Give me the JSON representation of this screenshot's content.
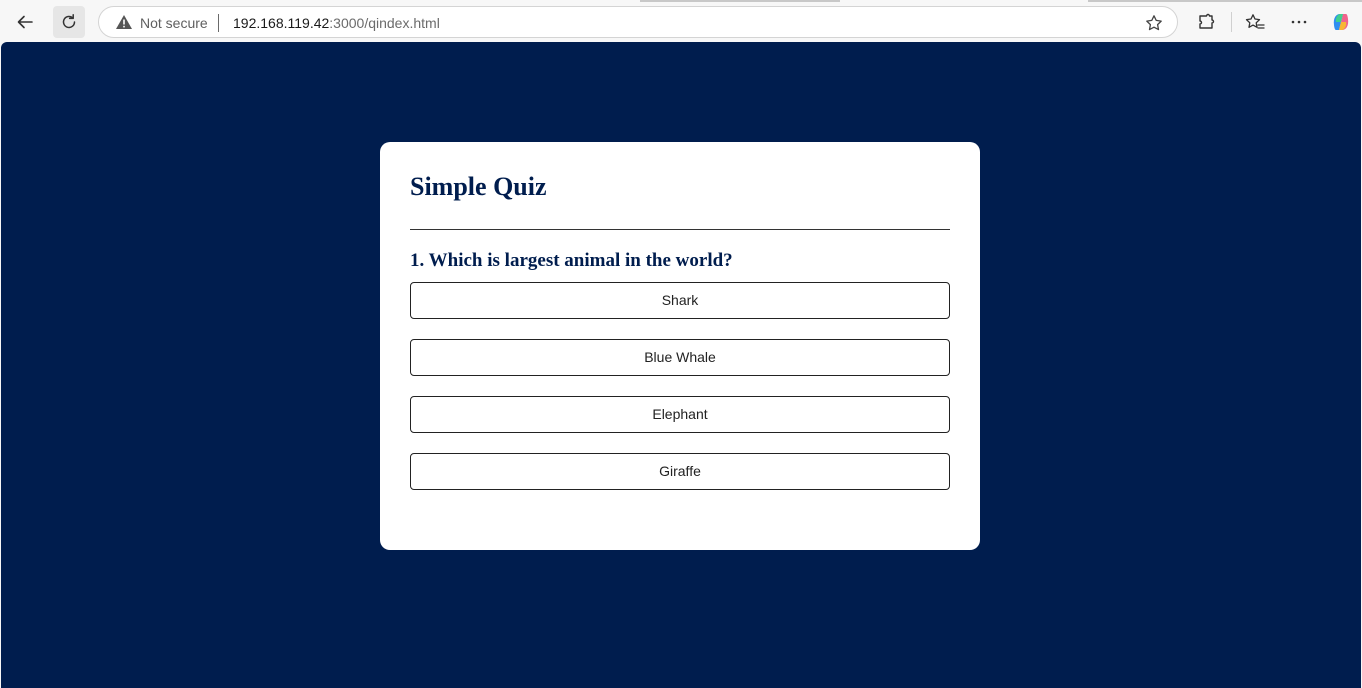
{
  "browser": {
    "security_label": "Not secure",
    "url_host": "192.168.119.42",
    "url_path": ":3000/qindex.html",
    "icons": [
      "back-icon",
      "refresh-icon",
      "warning-icon",
      "favorite-star-icon",
      "extensions-icon",
      "favorites-icon",
      "more-icon",
      "copilot-icon"
    ]
  },
  "quiz": {
    "title": "Simple Quiz",
    "question": "1. Which is largest animal in the world?",
    "answers": [
      "Shark",
      "Blue Whale",
      "Elephant",
      "Giraffe"
    ]
  },
  "colors": {
    "page_background": "#001d4e",
    "card_background": "#ffffff",
    "heading_text": "#001d4e"
  }
}
